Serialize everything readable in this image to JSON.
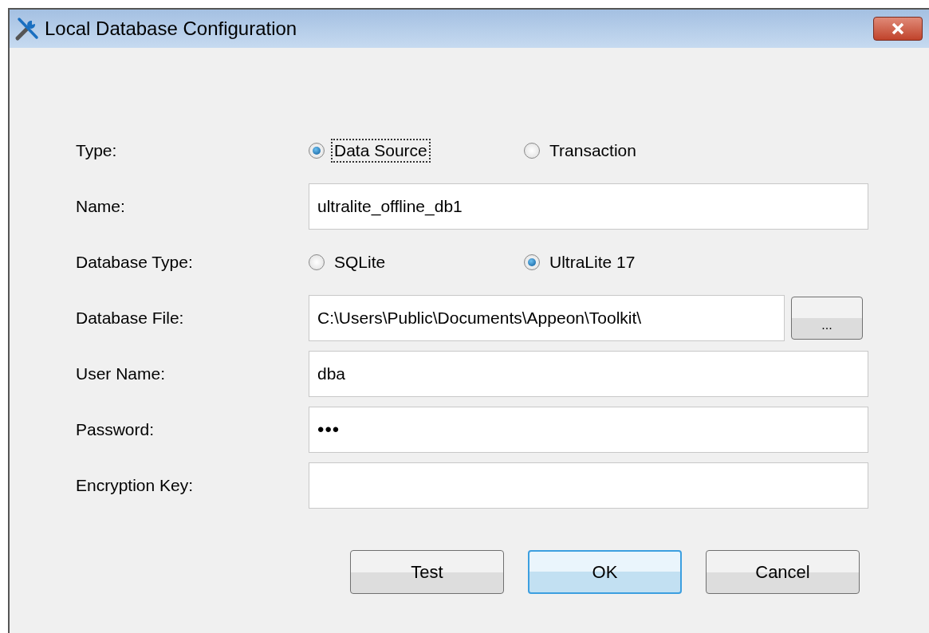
{
  "window": {
    "title": "Local Database Configuration"
  },
  "rows": [
    {
      "kind": "radio",
      "label": "Type:",
      "options": [
        {
          "label": "Data Source",
          "selected": true,
          "focused": true
        },
        {
          "label": "Transaction",
          "selected": false,
          "focused": false
        }
      ]
    },
    {
      "kind": "text",
      "label": "Name:",
      "value": "ultralite_offline_db1"
    },
    {
      "kind": "radio",
      "label": "Database Type:",
      "options": [
        {
          "label": "SQLite",
          "selected": false,
          "focused": false
        },
        {
          "label": "UltraLite 17",
          "selected": true,
          "focused": false
        }
      ]
    },
    {
      "kind": "file",
      "label": "Database File:",
      "value": "C:\\Users\\Public\\Documents\\Appeon\\Toolkit\\",
      "browse": "..."
    },
    {
      "kind": "text",
      "label": "User Name:",
      "value": "dba"
    },
    {
      "kind": "password",
      "label": "Password:",
      "value": "•••"
    },
    {
      "kind": "text",
      "label": "Encryption Key:"
    }
  ],
  "buttons": [
    {
      "label": "Test",
      "default": false
    },
    {
      "label": "OK",
      "default": true
    },
    {
      "label": "Cancel",
      "default": false
    }
  ]
}
